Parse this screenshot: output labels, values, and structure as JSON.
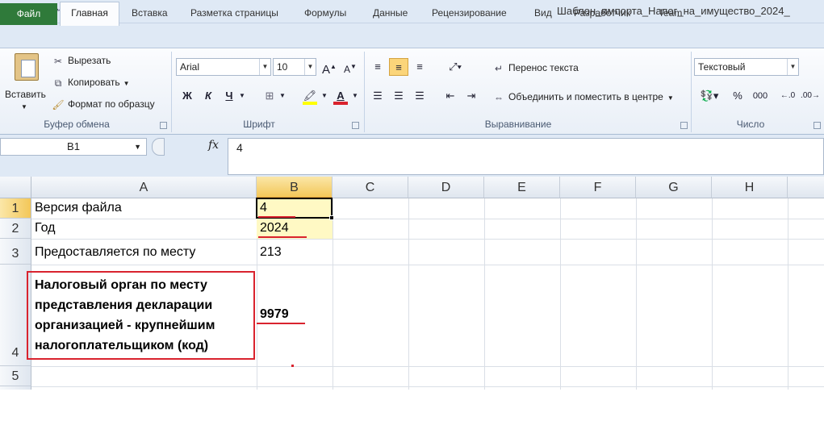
{
  "window": {
    "title": "Шаблон_импорта_Налог_на_имущество_2024_"
  },
  "tabs": [
    "Файл",
    "Главная",
    "Вставка",
    "Разметка страницы",
    "Формулы",
    "Данные",
    "Рецензирование",
    "Вид",
    "Разработчик",
    "Team"
  ],
  "clipboard": {
    "paste": "Вставить",
    "cut": "Вырезать",
    "copy": "Копировать",
    "format_painter": "Формат по образцу",
    "label": "Буфер обмена"
  },
  "font": {
    "name": "Arial",
    "size": "10",
    "bold": "Ж",
    "italic": "К",
    "underline": "Ч",
    "label": "Шрифт"
  },
  "alignment": {
    "wrap": "Перенос текста",
    "merge": "Объединить и поместить в центре",
    "label": "Выравнивание"
  },
  "number": {
    "format": "Текстовый",
    "percent": "%",
    "thousands": "000",
    "label": "Число"
  },
  "formula_bar": {
    "name_box": "B1",
    "fx": "fx",
    "value": "4"
  },
  "columns": [
    "A",
    "B",
    "C",
    "D",
    "E",
    "F",
    "G",
    "H"
  ],
  "rows": [
    "1",
    "2",
    "3",
    "4",
    "5"
  ],
  "cells": {
    "A1": "Версия файла",
    "B1": "4",
    "A2": "Год",
    "B2": "2024",
    "A3": "Предоставляется по месту",
    "B3": "213",
    "A4": "Налоговый орган по месту представления декларации организацией - крупнейшим налогоплательщиком (код)",
    "B4": "9979"
  },
  "colors": {
    "accent_red": "#d9232e",
    "file_tab": "#2f7a3a",
    "selected_col": "#f7d96b",
    "highlight_yellow": "#fff9c4"
  }
}
